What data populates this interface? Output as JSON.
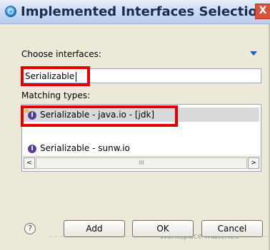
{
  "window": {
    "title": "Implemented Interfaces Selection",
    "close_glyph": "X"
  },
  "choose": {
    "label": "Choose interfaces:",
    "input_value": "Serializable"
  },
  "matching": {
    "label": "Matching types:",
    "items": [
      {
        "text": "Serializable - java.io - [jdk]",
        "icon": "interface-icon"
      },
      {
        "text": "Serializable - sunw.io",
        "icon": "interface-icon"
      }
    ],
    "separator_text": "Workspace matches"
  },
  "buttons": {
    "help": "?",
    "add": "Add",
    "ok": "OK",
    "cancel": "Cancel"
  },
  "scroll": {
    "left": "<",
    "right": ">",
    "thumb": "III"
  }
}
